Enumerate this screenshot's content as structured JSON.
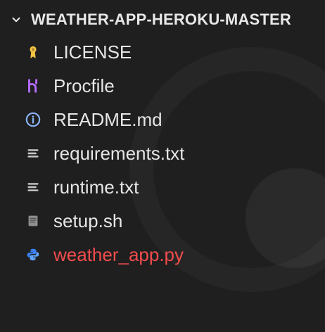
{
  "explorer": {
    "section_title": "WEATHER-APP-HEROKU-MASTER",
    "items": [
      {
        "label": "LICENSE",
        "icon": "license-icon"
      },
      {
        "label": "Procfile",
        "icon": "heroku-procfile-icon"
      },
      {
        "label": "README.md",
        "icon": "info-icon"
      },
      {
        "label": "requirements.txt",
        "icon": "text-lines-icon"
      },
      {
        "label": "runtime.txt",
        "icon": "text-lines-icon"
      },
      {
        "label": "setup.sh",
        "icon": "shell-script-icon"
      },
      {
        "label": "weather_app.py",
        "icon": "python-icon",
        "state": "modified"
      }
    ]
  },
  "colors": {
    "background": "#1f1f1f",
    "text": "#e6e6e6",
    "modified_red": "#f14c4c",
    "license_yellow": "#f5c542",
    "procfile_purple": "#b36bff",
    "info_blue": "#8ab4f8",
    "file_icon_gray": "#c9c9c9",
    "python_blue": "#3b82f6"
  }
}
